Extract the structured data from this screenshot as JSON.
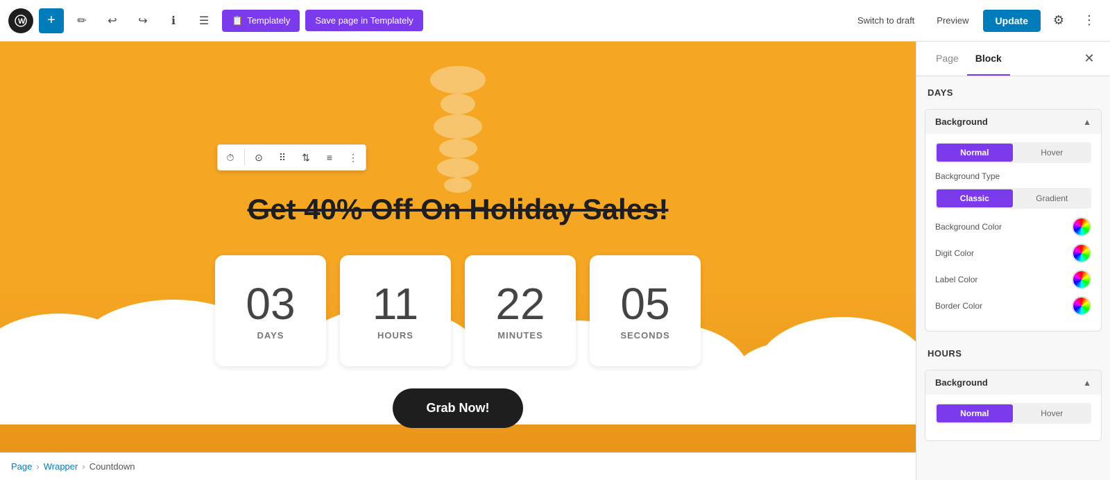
{
  "toolbar": {
    "add_label": "+",
    "tools_label": "✏",
    "undo_label": "↩",
    "redo_label": "↪",
    "info_label": "ℹ",
    "list_label": "☰",
    "templately_label": "Templately",
    "save_templately_label": "Save page in Templately",
    "switch_draft_label": "Switch to draft",
    "preview_label": "Preview",
    "update_label": "Update",
    "settings_label": "⚙",
    "more_label": "⋮"
  },
  "canvas": {
    "title_part1": "Get 40% ",
    "title_strike": "Off",
    "title_part2": " On Holiday Sales!",
    "countdown": {
      "days": {
        "value": "03",
        "label": "DAYS"
      },
      "hours": {
        "value": "11",
        "label": "HOURS"
      },
      "minutes": {
        "value": "22",
        "label": "MINUTES"
      },
      "seconds": {
        "value": "05",
        "label": "SECONDS"
      }
    },
    "cta_label": "Grab Now!"
  },
  "breadcrumb": {
    "page": "Page",
    "wrapper": "Wrapper",
    "countdown": "Countdown",
    "sep": "›"
  },
  "panel": {
    "page_tab": "Page",
    "block_tab": "Block",
    "close_icon": "✕",
    "days_section": "DAYS",
    "hours_section": "HOURS",
    "background_label": "Background",
    "background_label2": "Background",
    "normal_label": "Normal",
    "hover_label": "Hover",
    "normal_label2": "Normal",
    "hover_label2": "Hover",
    "background_type_label": "Background Type",
    "classic_label": "Classic",
    "gradient_label": "Gradient",
    "background_color_label": "Background Color",
    "digit_color_label": "Digit Color",
    "label_color_label": "Label Color",
    "border_color_label": "Border Color"
  }
}
